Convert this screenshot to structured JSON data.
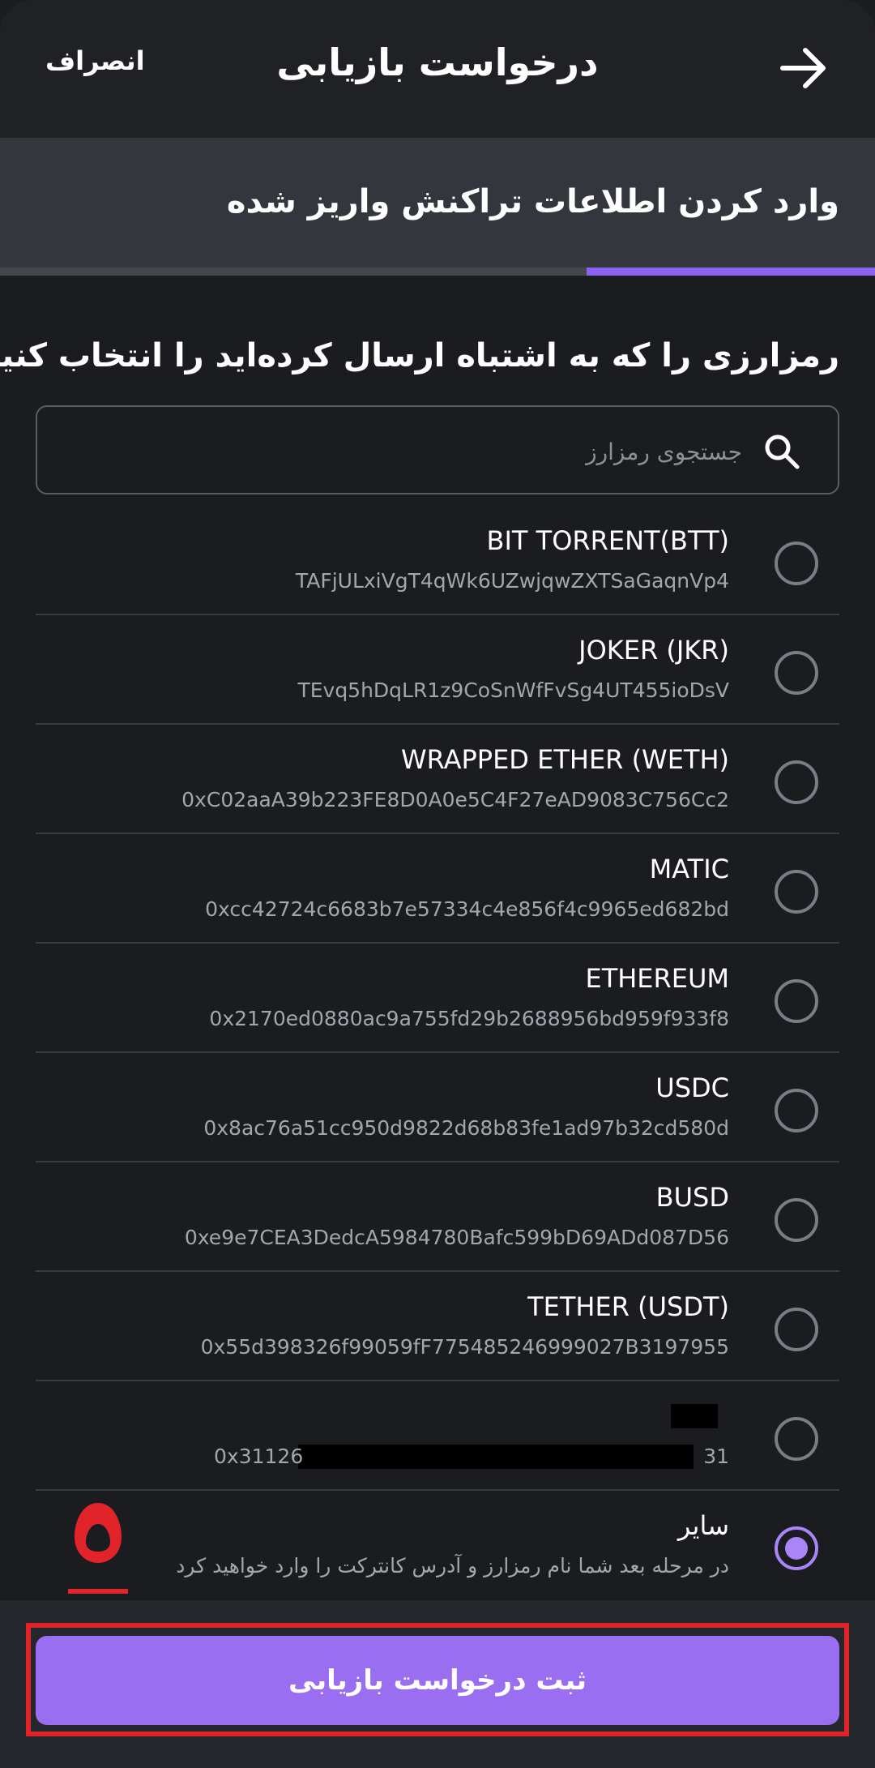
{
  "header": {
    "title": "درخواست بازیابی",
    "cancel_label": "انصراف",
    "back_icon": "arrow-right-icon"
  },
  "step": {
    "title": "وارد کردن اطلاعات تراکنش واریز شده",
    "progress_fraction": 0.33
  },
  "prompt": "رمزارزی را که به اشتباه ارسال کرده‌اید را انتخاب کنید",
  "search": {
    "placeholder": "جستجوی رمزارز",
    "icon": "search-icon"
  },
  "tokens": [
    {
      "name": "BIT TORRENT(BTT)",
      "address": "TAFjULxiVgT4qWk6UZwjqwZXTSaGaqnVp4",
      "selected": false
    },
    {
      "name": "JOKER (JKR)",
      "address": "TEvq5hDqLR1z9CoSnWfFvSg4UT455ioDsV",
      "selected": false
    },
    {
      "name": "WRAPPED ETHER (WETH)",
      "address": "0xC02aaA39b223FE8D0A0e5C4F27eAD9083C756Cc2",
      "selected": false
    },
    {
      "name": "MATIC",
      "address": "0xcc42724c6683b7e57334c4e856f4c9965ed682bd",
      "selected": false
    },
    {
      "name": "ETHEREUM",
      "address": "0x2170ed0880ac9a755fd29b2688956bd959f933f8",
      "selected": false
    },
    {
      "name": "USDC",
      "address": "0x8ac76a51cc950d9822d68b83fe1ad97b32cd580d",
      "selected": false
    },
    {
      "name": "BUSD",
      "address": "0xe9e7CEA3DedcA5984780Bafc599bD69ADd087D56",
      "selected": false
    },
    {
      "name": "TETHER (USDT)",
      "address": "0x55d398326f99059fF775485246999027B3197955",
      "selected": false
    }
  ],
  "redacted_token": {
    "address_start": "0x31126",
    "address_end": "31",
    "selected": false
  },
  "other_option": {
    "name": "سایر",
    "description": "در مرحله بعد شما نام رمزارز و آدرس کانترکت را وارد خواهید کرد",
    "selected": true
  },
  "annotation": {
    "label": "۵",
    "color": "#e0242a"
  },
  "submit_label": "ثبت درخواست بازیابی",
  "colors": {
    "background": "#1b1c20",
    "accent": "#9a6ef0",
    "progress": "#8b63f0",
    "radio_selected": "#a985f8"
  }
}
